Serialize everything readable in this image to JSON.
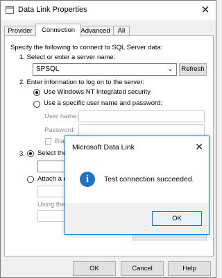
{
  "window": {
    "title": "Data Link Properties",
    "close_glyph": "✕"
  },
  "tabs": [
    {
      "label": "Provider",
      "active": false
    },
    {
      "label": "Connection",
      "active": true
    },
    {
      "label": "Advanced",
      "active": false
    },
    {
      "label": "All",
      "active": false
    }
  ],
  "connection": {
    "instruction": "Specify the following to connect to SQL Server data:",
    "step1_label": "1. Select or enter a server name:",
    "server_value": "SPSQL",
    "refresh_label": "Refresh",
    "step2_label": "2. Enter information to log on to the server:",
    "radio_windows_label": "Use Windows NT Integrated security",
    "radio_specific_label": "Use a specific user name and password:",
    "username_label": "User name:",
    "password_label": "Password:",
    "blank_password_label": "Blan",
    "step3_prefix": "3.",
    "radio_select_db_label": "Select the",
    "radio_attach_label": "Attach a d",
    "using_label": "Using the"
  },
  "dialog": {
    "title": "Microsoft Data Link",
    "close_glyph": "✕",
    "icon": "info-icon",
    "message": "Test connection succeeded.",
    "ok_label": "OK"
  },
  "footer": {
    "ok_label": "OK",
    "cancel_label": "Cancel",
    "help_label": "Help"
  }
}
